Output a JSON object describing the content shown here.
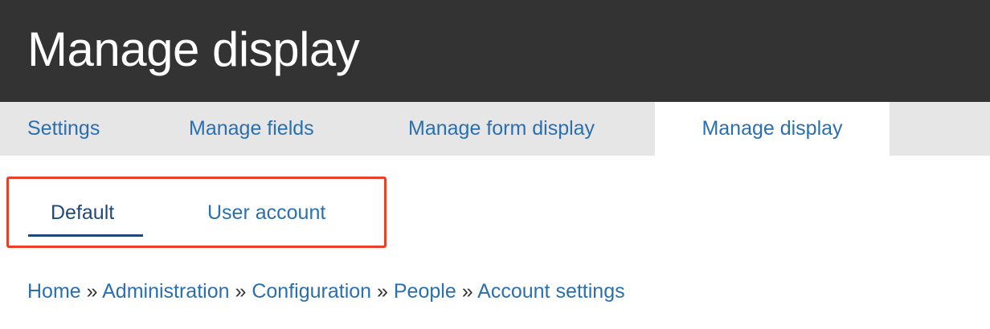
{
  "header": {
    "title": "Manage display"
  },
  "primary_tabs": [
    {
      "label": "Settings",
      "active": false
    },
    {
      "label": "Manage fields",
      "active": false
    },
    {
      "label": "Manage form display",
      "active": false
    },
    {
      "label": "Manage display",
      "active": true
    }
  ],
  "secondary_tabs": [
    {
      "label": "Default",
      "active": true
    },
    {
      "label": "User account",
      "active": false
    }
  ],
  "breadcrumb": {
    "items": [
      "Home",
      "Administration",
      "Configuration",
      "People",
      "Account settings"
    ],
    "separator": "»"
  },
  "colors": {
    "header_bg": "#333333",
    "tabs_bg": "#e6e6e6",
    "link": "#2a6fb0",
    "active_link": "#1e4a7a",
    "highlight_border": "#e8402a"
  }
}
